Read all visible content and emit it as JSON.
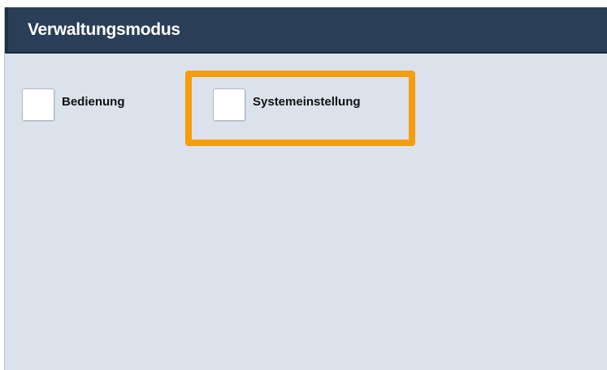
{
  "header": {
    "title": "Verwaltungsmodus"
  },
  "options": [
    {
      "label": "Bedienung",
      "checked": false,
      "highlighted": false
    },
    {
      "label": "Systemeinstellung",
      "checked": false,
      "highlighted": true
    }
  ],
  "colors": {
    "header_bg": "#2b3e58",
    "panel_bg": "#dbe2ec",
    "highlight": "#f59d0d"
  }
}
